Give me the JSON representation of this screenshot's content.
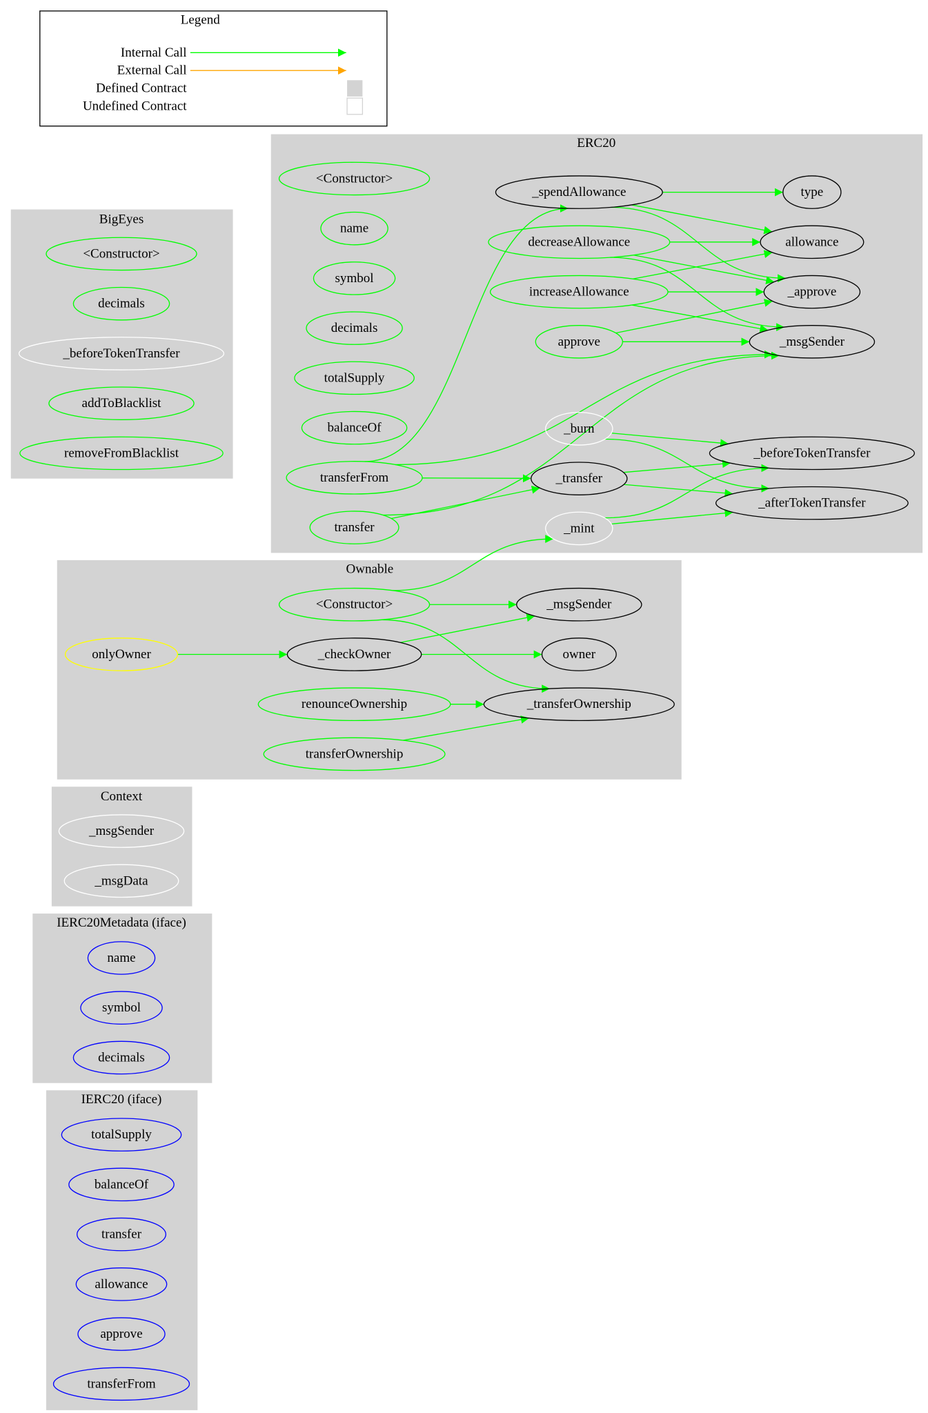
{
  "legend": {
    "title": "Legend",
    "items": [
      {
        "label": "Internal Call",
        "kind": "arrow",
        "color": "#00ff00"
      },
      {
        "label": "External Call",
        "kind": "arrow",
        "color": "#ffa500"
      },
      {
        "label": "Defined Contract",
        "kind": "box",
        "color": "#d3d3d3"
      },
      {
        "label": "Undefined Contract",
        "kind": "box",
        "color": "#ffffff"
      }
    ]
  },
  "colors": {
    "cluster_fill": "#d3d3d3",
    "internal_call": "#00ff00",
    "public": "#00ff00",
    "internal": "#000000",
    "undefined": "#ffffff",
    "interface": "#0000ff",
    "modifier": "#ffff00"
  },
  "clusters": [
    {
      "id": "ERC20",
      "title": "ERC20",
      "nodes": [
        {
          "id": "erc20_ctor",
          "label": "<Constructor>",
          "color": "#00ff00"
        },
        {
          "id": "erc20_name",
          "label": "name",
          "color": "#00ff00"
        },
        {
          "id": "erc20_symbol",
          "label": "symbol",
          "color": "#00ff00"
        },
        {
          "id": "erc20_decimals",
          "label": "decimals",
          "color": "#00ff00"
        },
        {
          "id": "erc20_totalSupply",
          "label": "totalSupply",
          "color": "#00ff00"
        },
        {
          "id": "erc20_balanceOf",
          "label": "balanceOf",
          "color": "#00ff00"
        },
        {
          "id": "erc20_transferFrom",
          "label": "transferFrom",
          "color": "#00ff00"
        },
        {
          "id": "erc20_transfer",
          "label": "transfer",
          "color": "#00ff00"
        },
        {
          "id": "erc20_spendAllowance",
          "label": "_spendAllowance",
          "color": "#000000"
        },
        {
          "id": "erc20_decreaseAllowance",
          "label": "decreaseAllowance",
          "color": "#00ff00"
        },
        {
          "id": "erc20_increaseAllowance",
          "label": "increaseAllowance",
          "color": "#00ff00"
        },
        {
          "id": "erc20_approve",
          "label": "approve",
          "color": "#00ff00"
        },
        {
          "id": "erc20_burn",
          "label": "_burn",
          "color": "#ffffff"
        },
        {
          "id": "erc20__transfer",
          "label": "_transfer",
          "color": "#000000"
        },
        {
          "id": "erc20_mint",
          "label": "_mint",
          "color": "#ffffff"
        },
        {
          "id": "erc20_type",
          "label": "type",
          "color": "#000000"
        },
        {
          "id": "erc20_allowance",
          "label": "allowance",
          "color": "#000000"
        },
        {
          "id": "erc20__approve",
          "label": "_approve",
          "color": "#000000"
        },
        {
          "id": "erc20_msgSender",
          "label": "_msgSender",
          "color": "#000000"
        },
        {
          "id": "erc20_beforeTokenTransfer",
          "label": "_beforeTokenTransfer",
          "color": "#000000"
        },
        {
          "id": "erc20_afterTokenTransfer",
          "label": "_afterTokenTransfer",
          "color": "#000000"
        }
      ]
    },
    {
      "id": "BigEyes",
      "title": "BigEyes",
      "nodes": [
        {
          "id": "be_ctor",
          "label": "<Constructor>",
          "color": "#00ff00"
        },
        {
          "id": "be_decimals",
          "label": "decimals",
          "color": "#00ff00"
        },
        {
          "id": "be_before",
          "label": "_beforeTokenTransfer",
          "color": "#ffffff"
        },
        {
          "id": "be_add",
          "label": "addToBlacklist",
          "color": "#00ff00"
        },
        {
          "id": "be_remove",
          "label": "removeFromBlacklist",
          "color": "#00ff00"
        }
      ]
    },
    {
      "id": "Ownable",
      "title": "Ownable",
      "nodes": [
        {
          "id": "own_onlyOwner",
          "label": "onlyOwner",
          "color": "#ffff00"
        },
        {
          "id": "own_ctor",
          "label": "<Constructor>",
          "color": "#00ff00"
        },
        {
          "id": "own_checkOwner",
          "label": "_checkOwner",
          "color": "#000000"
        },
        {
          "id": "own_renounce",
          "label": "renounceOwnership",
          "color": "#00ff00"
        },
        {
          "id": "own_transferOwnership",
          "label": "transferOwnership",
          "color": "#00ff00"
        },
        {
          "id": "own_msgSender",
          "label": "_msgSender",
          "color": "#000000"
        },
        {
          "id": "own_owner",
          "label": "owner",
          "color": "#000000"
        },
        {
          "id": "own__transferOwnership",
          "label": "_transferOwnership",
          "color": "#000000"
        }
      ]
    },
    {
      "id": "Context",
      "title": "Context",
      "nodes": [
        {
          "id": "ctx_msgSender",
          "label": "_msgSender",
          "color": "#ffffff"
        },
        {
          "id": "ctx_msgData",
          "label": "_msgData",
          "color": "#ffffff"
        }
      ]
    },
    {
      "id": "IERC20Metadata",
      "title": "IERC20Metadata  (iface)",
      "nodes": [
        {
          "id": "meta_name",
          "label": "name",
          "color": "#0000ff"
        },
        {
          "id": "meta_symbol",
          "label": "symbol",
          "color": "#0000ff"
        },
        {
          "id": "meta_decimals",
          "label": "decimals",
          "color": "#0000ff"
        }
      ]
    },
    {
      "id": "IERC20",
      "title": "IERC20  (iface)",
      "nodes": [
        {
          "id": "i_totalSupply",
          "label": "totalSupply",
          "color": "#0000ff"
        },
        {
          "id": "i_balanceOf",
          "label": "balanceOf",
          "color": "#0000ff"
        },
        {
          "id": "i_transfer",
          "label": "transfer",
          "color": "#0000ff"
        },
        {
          "id": "i_allowance",
          "label": "allowance",
          "color": "#0000ff"
        },
        {
          "id": "i_approve",
          "label": "approve",
          "color": "#0000ff"
        },
        {
          "id": "i_transferFrom",
          "label": "transferFrom",
          "color": "#0000ff"
        }
      ]
    }
  ],
  "edges": [
    [
      "erc20_spendAllowance",
      "erc20_type"
    ],
    [
      "erc20_spendAllowance",
      "erc20_allowance"
    ],
    [
      "erc20_spendAllowance",
      "erc20__approve"
    ],
    [
      "erc20_decreaseAllowance",
      "erc20_allowance"
    ],
    [
      "erc20_decreaseAllowance",
      "erc20__approve"
    ],
    [
      "erc20_decreaseAllowance",
      "erc20_msgSender"
    ],
    [
      "erc20_increaseAllowance",
      "erc20_allowance"
    ],
    [
      "erc20_increaseAllowance",
      "erc20__approve"
    ],
    [
      "erc20_increaseAllowance",
      "erc20_msgSender"
    ],
    [
      "erc20_approve",
      "erc20__approve"
    ],
    [
      "erc20_approve",
      "erc20_msgSender"
    ],
    [
      "erc20_transferFrom",
      "erc20_spendAllowance"
    ],
    [
      "erc20_transferFrom",
      "erc20_msgSender"
    ],
    [
      "erc20_transferFrom",
      "erc20__transfer"
    ],
    [
      "erc20_transfer",
      "erc20_msgSender"
    ],
    [
      "erc20_transfer",
      "erc20__transfer"
    ],
    [
      "erc20_burn",
      "erc20_beforeTokenTransfer"
    ],
    [
      "erc20_burn",
      "erc20_afterTokenTransfer"
    ],
    [
      "erc20__transfer",
      "erc20_beforeTokenTransfer"
    ],
    [
      "erc20__transfer",
      "erc20_afterTokenTransfer"
    ],
    [
      "erc20_mint",
      "erc20_beforeTokenTransfer"
    ],
    [
      "erc20_mint",
      "erc20_afterTokenTransfer"
    ],
    [
      "own_ctor",
      "erc20_mint"
    ],
    [
      "own_ctor",
      "own_msgSender"
    ],
    [
      "own_ctor",
      "own__transferOwnership"
    ],
    [
      "own_onlyOwner",
      "own_checkOwner"
    ],
    [
      "own_checkOwner",
      "own_msgSender"
    ],
    [
      "own_checkOwner",
      "own_owner"
    ],
    [
      "own_renounce",
      "own__transferOwnership"
    ],
    [
      "own_transferOwnership",
      "own__transferOwnership"
    ]
  ]
}
